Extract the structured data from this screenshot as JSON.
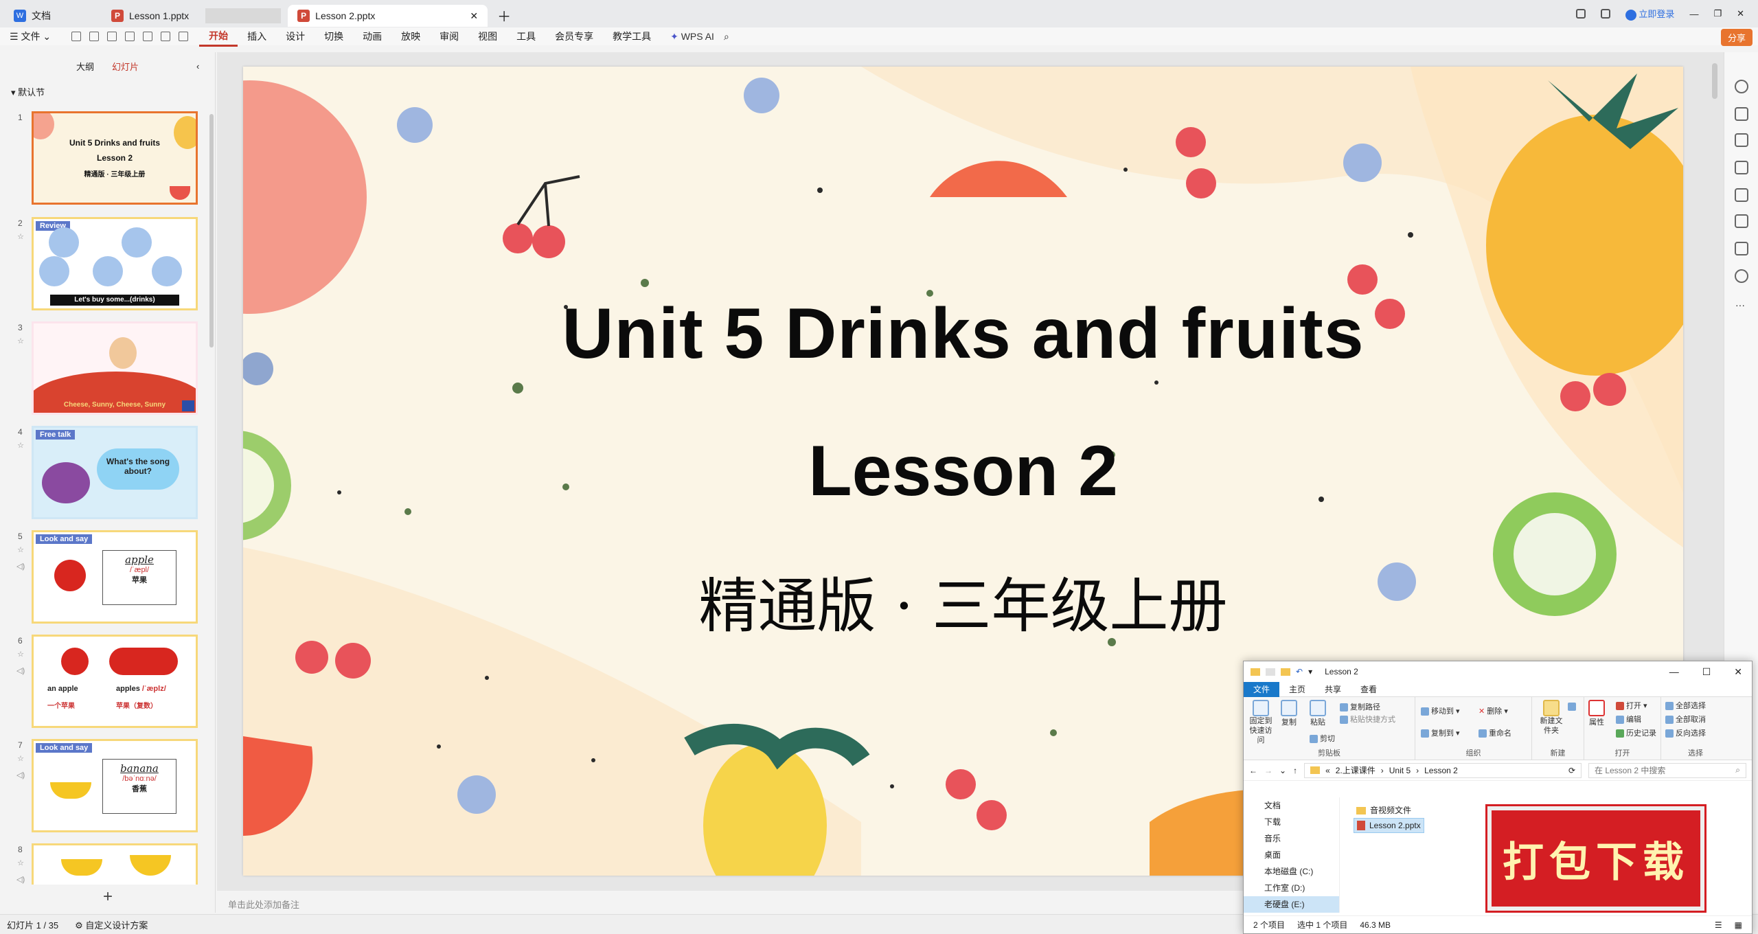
{
  "tabs": [
    {
      "label": "文档",
      "logo": "D"
    },
    {
      "label": "Lesson 1.pptx",
      "logo": "P"
    },
    {
      "label": "Lesson 2.pptx",
      "logo": "P"
    }
  ],
  "login": "立即登录",
  "menu": {
    "file": "文件",
    "items": [
      "开始",
      "插入",
      "设计",
      "切换",
      "动画",
      "放映",
      "审阅",
      "视图",
      "工具",
      "会员专享",
      "教学工具"
    ],
    "ai": "WPS AI",
    "share": "分享"
  },
  "panel": {
    "outline": "大纲",
    "slides": "幻灯片",
    "section": "默认节"
  },
  "thumbs": [
    {
      "num": "1",
      "line1": "Unit 5  Drinks and fruits",
      "line2": "Lesson 2",
      "line3": "精通版 · 三年级上册"
    },
    {
      "num": "2",
      "label": "Review",
      "caption": "Let's buy some...(drinks)"
    },
    {
      "num": "3",
      "caption": "Cheese, Sunny, Cheese, Sunny"
    },
    {
      "num": "4",
      "label": "Free talk",
      "bubble": "What's the song about?"
    },
    {
      "num": "5",
      "label": "Look and say",
      "word": "apple",
      "ipa": "/ˈæpl/",
      "cn": "苹果"
    },
    {
      "num": "6",
      "w1": "an apple",
      "w1cn": "一个苹果",
      "w2": "apples",
      "w2ipa": "/ˈæplz/",
      "w2cn": "苹果（复数）"
    },
    {
      "num": "7",
      "label": "Look and say",
      "word": "banana",
      "ipa": "/bəˈnɑːnə/",
      "cn": "香蕉"
    },
    {
      "num": "8"
    }
  ],
  "slide": {
    "title": "Unit 5  Drinks and fruits",
    "lesson": "Lesson 2",
    "subtitle": "精通版 · 三年级上册"
  },
  "notes_placeholder": "单击此处添加备注",
  "status": {
    "slide": "幻灯片 1 / 35",
    "design": "自定义设计方案"
  },
  "explorer": {
    "title": "Lesson 2",
    "ribbon_tabs": [
      "文件",
      "主页",
      "共享",
      "查看"
    ],
    "groups": {
      "clipboard": {
        "name": "剪贴板",
        "pin": "固定到快速访问",
        "copy": "复制",
        "paste": "粘贴",
        "copypath": "复制路径",
        "pasteshort": "粘贴快捷方式",
        "cut": "剪切"
      },
      "organize": {
        "name": "组织",
        "move": "移动到",
        "copyto": "复制到",
        "delete": "删除",
        "rename": "重命名"
      },
      "new": {
        "name": "新建",
        "folder": "新建文件夹"
      },
      "open": {
        "name": "打开",
        "props": "属性",
        "open": "打开",
        "edit": "编辑",
        "history": "历史记录"
      },
      "select": {
        "name": "选择",
        "all": "全部选择",
        "none": "全部取消",
        "invert": "反向选择"
      }
    },
    "path": [
      "2.上课课件",
      "Unit 5",
      "Lesson 2"
    ],
    "search": "在 Lesson 2 中搜索",
    "nav": [
      "文档",
      "下载",
      "音乐",
      "桌面",
      "本地磁盘 (C:)",
      "工作室 (D:)",
      "老硬盘 (E:)"
    ],
    "files": [
      "音视频文件",
      "Lesson 2.pptx"
    ],
    "status": {
      "count": "2 个项目",
      "selected": "选中 1 个项目",
      "size": "46.3 MB"
    }
  },
  "download_badge": "打包下载",
  "colors": {
    "accent": "#c3382b",
    "share": "#e8742e",
    "badge": "#d41e23"
  }
}
